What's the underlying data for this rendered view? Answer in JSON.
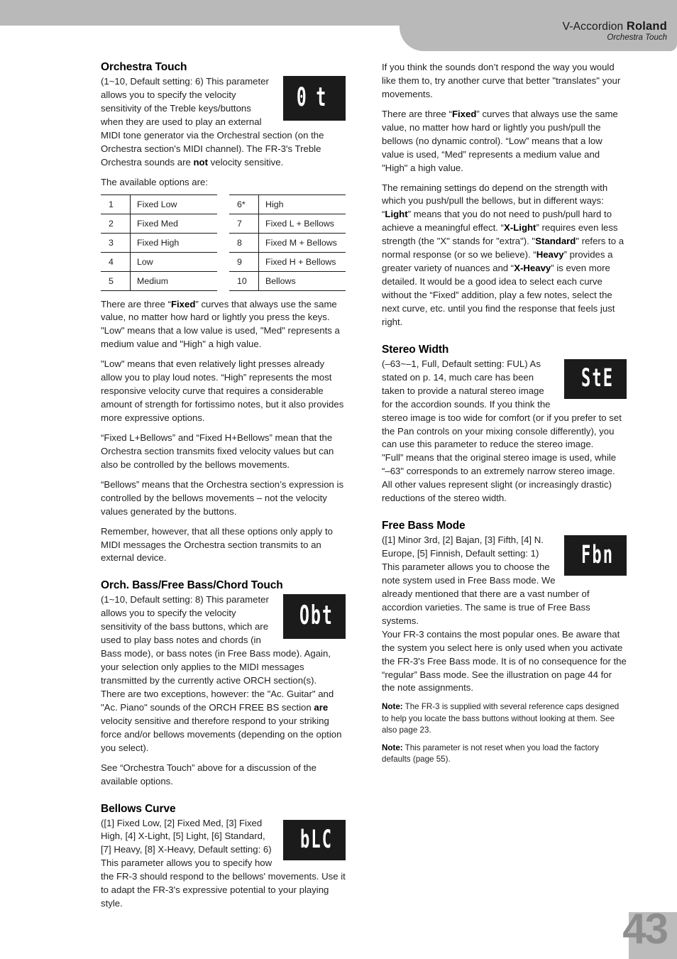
{
  "header": {
    "product": "V-Accordion",
    "brand": "Roland",
    "subtitle": "Orchestra Touch"
  },
  "footer": {
    "page_number": "43"
  },
  "left_column": {
    "orchestra_touch": {
      "heading": "Orchestra Touch",
      "lcd": "0t",
      "para1_pre": "(1~10, Default setting: 6) This parameter allows you to specify the velocity sensitivity of the Treble keys/buttons when they are used to play an external MIDI tone generator via the Orchestral section (on the Orchestra section's MIDI channel). The FR-3's Treble Orchestra sounds are ",
      "para1_bold": "not",
      "para1_post": " velocity sensitive.",
      "para2": "The available options are:",
      "table_left": [
        {
          "num": "1",
          "label": "Fixed Low"
        },
        {
          "num": "2",
          "label": "Fixed Med"
        },
        {
          "num": "3",
          "label": "Fixed High"
        },
        {
          "num": "4",
          "label": "Low"
        },
        {
          "num": "5",
          "label": "Medium"
        }
      ],
      "table_right": [
        {
          "num": "6*",
          "label": "High"
        },
        {
          "num": "7",
          "label": "Fixed L + Bellows"
        },
        {
          "num": "8",
          "label": "Fixed M + Bellows"
        },
        {
          "num": "9",
          "label": "Fixed H + Bellows"
        },
        {
          "num": "10",
          "label": "Bellows"
        }
      ],
      "para3_pre": "There are three “",
      "para3_bold": "Fixed",
      "para3_post": "” curves that always use the same value, no matter how hard or lightly you press the keys. \"Low\" means that a low value is used, \"Med\" represents a medium value and \"High\" a high value.",
      "para4": "\"Low\" means that even relatively light presses already allow you to play loud notes. “High” represents the most responsive velocity curve that requires a considerable amount of strength for fortissimo notes, but it also provides more expressive options.",
      "para5": "“Fixed L+Bellows” and “Fixed H+Bellows” mean that the Orchestra section transmits fixed velocity values but can also be controlled by the bellows movements.",
      "para6": "“Bellows” means that the Orchestra section’s expression is controlled by the bellows movements – not the velocity values generated by the buttons.",
      "para7": "Remember, however, that all these options only apply to MIDI messages the Orchestra section transmits to an external device."
    },
    "orch_bass": {
      "heading": "Orch. Bass/Free Bass/Chord Touch",
      "lcd": "Obt",
      "para1": "(1~10, Default setting: 8) This parameter allows you to specify the velocity sensitivity of the bass buttons, which are used to play bass notes and chords (in Bass mode), or bass notes (in Free Bass mode). Again, your selection only applies to the MIDI messages transmitted by the currently active ORCH section(s).",
      "para2_pre": "There are two exceptions, however: the \"Ac. Guitar\" and \"Ac. Piano\" sounds of the ORCH FREE BS section ",
      "para2_bold": "are",
      "para2_post": " velocity sensitive and therefore respond to your striking force and/or bellows movements (depending on the option you select).",
      "para3": "See “Orchestra Touch” above for a discussion of the available options."
    },
    "bellows_curve": {
      "heading": "Bellows Curve",
      "lcd": "bLC",
      "para1": "([1] Fixed Low, [2] Fixed Med, [3] Fixed High, [4] X-Light, [5] Light, [6] Standard, [7] Heavy, [8] X-Heavy, Default setting: 6) This parameter allows you to specify how the FR-3 should respond to the bellows' movements. Use it to adapt the FR-3's expressive potential to your playing style."
    }
  },
  "right_column": {
    "intro": {
      "para1": "If you think the sounds don’t respond the way you would like them to, try another curve that better \"translates\" your movements.",
      "para2_pre": "There are three “",
      "para2_bold": "Fixed",
      "para2_post": "” curves that always use the same value, no matter how hard or lightly you push/pull the bellows (no dynamic control). “Low” means that a low value is used, “Med” represents a medium value and \"High\" a high value.",
      "para3_segments": [
        {
          "text": "The remaining settings do depend on the strength with which you push/pull the bellows, but in different ways: “",
          "bold": false
        },
        {
          "text": "Light",
          "bold": true
        },
        {
          "text": "” means that you do not need to push/pull hard to achieve a meaningful effect. “",
          "bold": false
        },
        {
          "text": "X-Light",
          "bold": true
        },
        {
          "text": "” requires even less strength (the \"X\" stands for \"extra\"). \"",
          "bold": false
        },
        {
          "text": "Standard",
          "bold": true
        },
        {
          "text": "\" refers to a normal response (or so we believe). “",
          "bold": false
        },
        {
          "text": "Heavy",
          "bold": true
        },
        {
          "text": "” provides a greater variety of nuances and “",
          "bold": false
        },
        {
          "text": "X-Heavy",
          "bold": true
        },
        {
          "text": "” is even more detailed. It would be a good idea to select each curve without the “Fixed” addition, play a few notes, select the next curve, etc. until you find the response that feels just right.",
          "bold": false
        }
      ]
    },
    "stereo_width": {
      "heading": "Stereo Width",
      "lcd": "StE",
      "para1": "(–63~–1, Full, Default setting: FUL) As stated on p. 14, much care has been taken to provide a natural stereo image for the accordion sounds. If you think the stereo image is too wide for comfort (or if you prefer to set the Pan controls on your mixing console differently), you can use this parameter to reduce the stereo image.",
      "para2": "\"Full” means that the original stereo image is used, while “–63\" corresponds to an extremely narrow stereo image. All other values represent slight (or increasingly drastic) reductions of the stereo width."
    },
    "free_bass_mode": {
      "heading": "Free Bass Mode",
      "lcd": "Fbn",
      "para1": "([1] Minor 3rd, [2] Bajan, [3] Fifth, [4] N. Europe, [5] Finnish, Default setting: 1) This parameter allows you to choose the note system used in Free Bass mode. We already mentioned that there are a vast number of accordion varieties. The same is true of Free Bass systems.",
      "para2": "Your FR-3 contains the most popular ones. Be aware that the system you select here is only used when you activate the FR-3's Free Bass mode. It is of no consequence for the “regular” Bass mode. See the illustration on page 44 for the note assignments.",
      "note1_label": "Note:",
      "note1_text": " The FR-3 is supplied with several reference caps designed to help you locate the bass buttons without looking at them. See also page 23.",
      "note2_label": "Note:",
      "note2_text": " This parameter is not reset when you load the factory defaults (page 55)."
    }
  }
}
